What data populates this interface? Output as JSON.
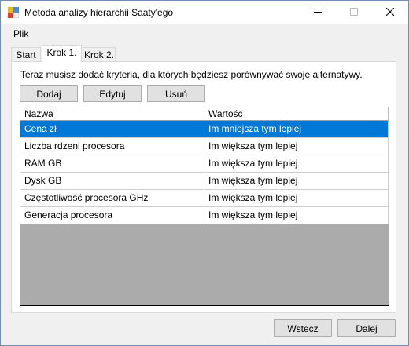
{
  "window": {
    "title": "Metoda analizy hierarchii Saaty'ego",
    "controls": [
      "minimize-icon",
      "maximize-icon",
      "close-icon"
    ]
  },
  "menu": {
    "items": [
      {
        "label": "Plik"
      }
    ]
  },
  "tabs": [
    {
      "label": "Start",
      "active": false
    },
    {
      "label": "Krok 1.",
      "active": true
    },
    {
      "label": "Krok 2.",
      "active": false
    }
  ],
  "panel": {
    "instruction": "Teraz musisz dodać kryteria, dla których będziesz porównywać swoje alternatywy.",
    "buttons": {
      "add": "Dodaj",
      "edit": "Edytuj",
      "delete": "Usuń"
    }
  },
  "grid": {
    "columns": [
      "Nazwa",
      "Wartość"
    ],
    "rows": [
      {
        "name": "Cena zł",
        "value": "Im mniejsza tym lepiej",
        "selected": true
      },
      {
        "name": "Liczba rdzeni procesora",
        "value": "Im większa tym lepiej",
        "selected": false
      },
      {
        "name": "RAM GB",
        "value": "Im większa tym lepiej",
        "selected": false
      },
      {
        "name": "Dysk GB",
        "value": "Im większa tym lepiej",
        "selected": false
      },
      {
        "name": "Częstotliwość procesora GHz",
        "value": "Im większa tym lepiej",
        "selected": false
      },
      {
        "name": "Generacja procesora",
        "value": "Im większa tym lepiej",
        "selected": false
      }
    ]
  },
  "footer": {
    "back": "Wstecz",
    "next": "Dalej"
  },
  "colors": {
    "selection": "#0078d7",
    "grid_empty": "#ababab"
  }
}
